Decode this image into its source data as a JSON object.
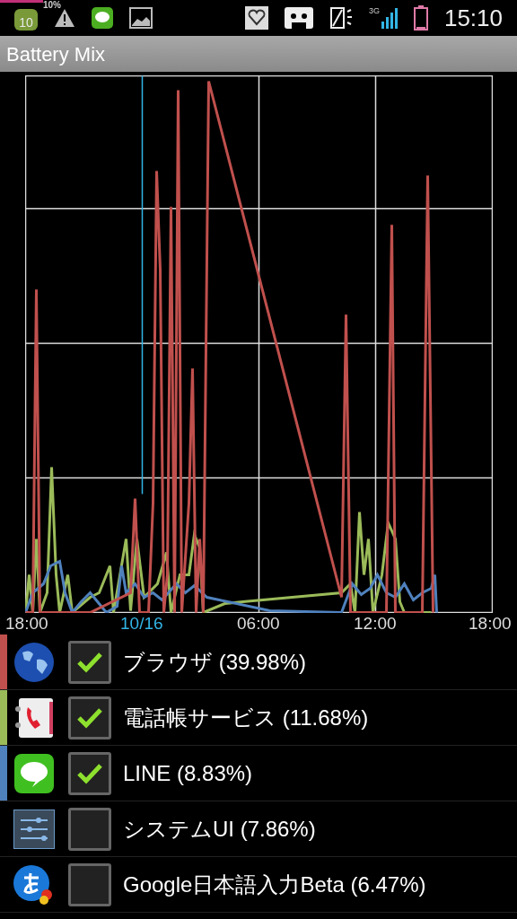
{
  "status_bar": {
    "progress_text": "10%",
    "badge": "10",
    "network": "3G",
    "time": "15:10"
  },
  "title": "Battery Mix",
  "chart": {
    "x_labels": [
      {
        "text": "18:00",
        "highlight": false
      },
      {
        "text": "10/16",
        "highlight": true
      },
      {
        "text": "06:00",
        "highlight": false
      },
      {
        "text": "12:00",
        "highlight": false
      },
      {
        "text": "18:00",
        "highlight": false
      }
    ]
  },
  "apps": [
    {
      "name": "ブラウザ (39.98%)",
      "checked": true,
      "color": "#c0504d"
    },
    {
      "name": "電話帳サービス (11.68%)",
      "checked": true,
      "color": "#9bbb59"
    },
    {
      "name": "LINE (8.83%)",
      "checked": true,
      "color": "#4f81bd"
    },
    {
      "name": "システムUI (7.86%)",
      "checked": false
    },
    {
      "name": "Google日本語入力Beta (6.47%)",
      "checked": false
    }
  ]
}
